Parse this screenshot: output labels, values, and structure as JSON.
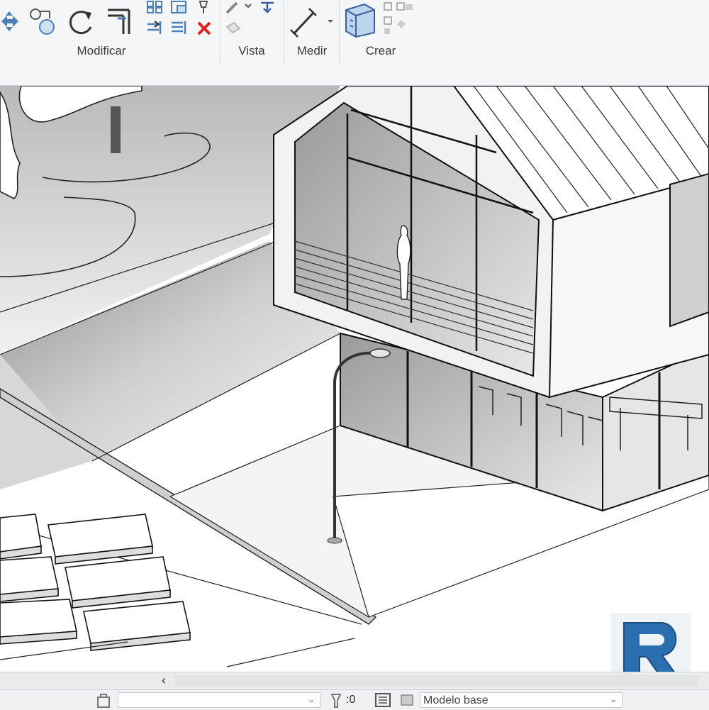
{
  "ribbon": {
    "panels": [
      {
        "label": "Modificar"
      },
      {
        "label": "Vista"
      },
      {
        "label": "Medir"
      },
      {
        "label": "Crear"
      }
    ],
    "icons": [
      "move-icon",
      "copy-icon",
      "rotate-icon",
      "trim-icon",
      "array-icon",
      "scale-icon",
      "pin-icon",
      "split-icon",
      "offset-icon",
      "delete-icon",
      "override-graphics-icon",
      "hide-icon",
      "measure-icon",
      "create-assembly-icon",
      "create-group-icon"
    ]
  },
  "status": {
    "count": ":0",
    "model": "Modelo base"
  },
  "scrollbar": {
    "left_arrow": "‹"
  },
  "logo": {
    "letter": "R"
  },
  "colors": {
    "ribbon_bg": "#f5f6f7",
    "logo_blue": "#2b6fb0",
    "delete_red": "#d9241e"
  }
}
